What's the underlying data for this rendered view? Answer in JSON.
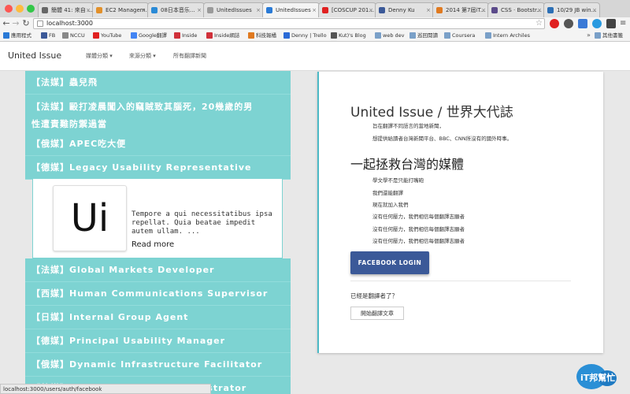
{
  "browser": {
    "tabs": [
      {
        "label": "簡體 41: 來自 ...",
        "icon": "document-icon",
        "color": "#666666"
      },
      {
        "label": "EC2 Managem...",
        "icon": "aws-icon",
        "color": "#e2902a"
      },
      {
        "label": "08日本音乐...",
        "icon": "play-icon",
        "color": "#2a8ad6"
      },
      {
        "label": "UnitedIssues",
        "icon": "page-icon",
        "color": "#9a9a9a"
      },
      {
        "label": "UnitedIssues",
        "icon": "angular-icon",
        "color": "#2a7ad6"
      },
      {
        "label": "[COSCUP 201...",
        "icon": "youtube-icon",
        "color": "#e02020"
      },
      {
        "label": "Denny Ku",
        "icon": "facebook-icon",
        "color": "#3b5998"
      },
      {
        "label": "2014 第7屆iT...",
        "icon": "ithome-icon",
        "color": "#e07a20"
      },
      {
        "label": "CSS · Bootstr...",
        "icon": "bootstrap-icon",
        "color": "#5b4a8a"
      },
      {
        "label": "10/29 JB win...",
        "icon": "calendar-icon",
        "color": "#2c6fb5"
      }
    ],
    "url": "localhost:3000",
    "bookmarks": [
      {
        "label": "應用程式",
        "color": "#2a7ad6"
      },
      {
        "label": "FB",
        "color": "#3b5998"
      },
      {
        "label": "NCCU",
        "color": "#888888"
      },
      {
        "label": "YouTube",
        "color": "#e02020"
      },
      {
        "label": "Google翻譯",
        "color": "#4285f4"
      },
      {
        "label": "Inside",
        "color": "#d0303a"
      },
      {
        "label": "Inside網誌",
        "color": "#d0303a"
      },
      {
        "label": "科技報橘",
        "color": "#e07a20"
      },
      {
        "label": "Denny | Trello",
        "color": "#2a6ad6"
      },
      {
        "label": "Kut)'s Blog",
        "color": "#555555"
      },
      {
        "label": "web dev",
        "color": "#7aa0c8"
      },
      {
        "label": "巡回閱讀",
        "color": "#7aa0c8"
      },
      {
        "label": "Coursera",
        "color": "#7aa0c8"
      },
      {
        "label": "Intern Archiles",
        "color": "#7aa0c8"
      },
      {
        "label": "其他書籤",
        "color": "#7aa0c8"
      }
    ],
    "bookmarks_overflow": "»",
    "status_url": "localhost:3000/users/auth/facebook"
  },
  "navbar": {
    "brand": "United Issue",
    "items": [
      "媒體分類 ▾",
      "來源分類 ▾",
      "所有翻譯新聞"
    ]
  },
  "articles_top": [
    {
      "tag": "【法媒】",
      "title": "蟲兒飛"
    },
    {
      "tag": "【法媒】",
      "title": "毆打凌晨闖入的竊賊致其腦死，20幾歲的男",
      "title2": "性遭責難防禦過當"
    },
    {
      "tag": "【俄媒】",
      "title": "APEC吃大便"
    },
    {
      "tag": "【德媒】",
      "title": "Legacy Usability Representative"
    }
  ],
  "featured": {
    "logo_text": "Ui",
    "excerpt": "Tempore a qui necessitatibus ipsa repellat. Quia beatae impedit autem ullam. ...",
    "read_more": "Read more"
  },
  "articles_bottom": [
    {
      "tag": "【法媒】",
      "title": "Global Markets Developer"
    },
    {
      "tag": "【西媒】",
      "title": "Human Communications Supervisor"
    },
    {
      "tag": "【日媒】",
      "title": "Internal Group Agent"
    },
    {
      "tag": "【德媒】",
      "title": "Principal Usability Manager"
    },
    {
      "tag": "【俄媒】",
      "title": "Dynamic Infrastructure Facilitator"
    },
    {
      "tag": "【韓媒】",
      "title": "Investor Markets Administrator"
    }
  ],
  "panel": {
    "title": "United Issue / 世界大代誌",
    "subtitle_lines": [
      "旨在翻譯不同語言的當地新聞，",
      "想提供給讀者台灣新聞平台、BBC、CNN所沒有的國外時事。"
    ],
    "heading": "一起拯救台灣的媒體",
    "mission_lines": [
      "學文學不是只能打嘴砲",
      "我們還能翻譯",
      "現在就加入我們",
      "沒有任何壓力，我們相信每個翻譯志願者",
      "沒有任何壓力，我們相信每個翻譯志願者",
      "沒有任何壓力，我們相信每個翻譯志願者"
    ],
    "fb_button": "FACEBOOK LOGIN",
    "question": "已經是翻譯者了？",
    "start_button": "開始翻譯文章"
  },
  "watermark": {
    "text": "iT邦幫忙"
  },
  "colors": {
    "teal": "#7dd3d2",
    "facebook": "#3b5998",
    "accent_border": "#4cb9c6"
  }
}
